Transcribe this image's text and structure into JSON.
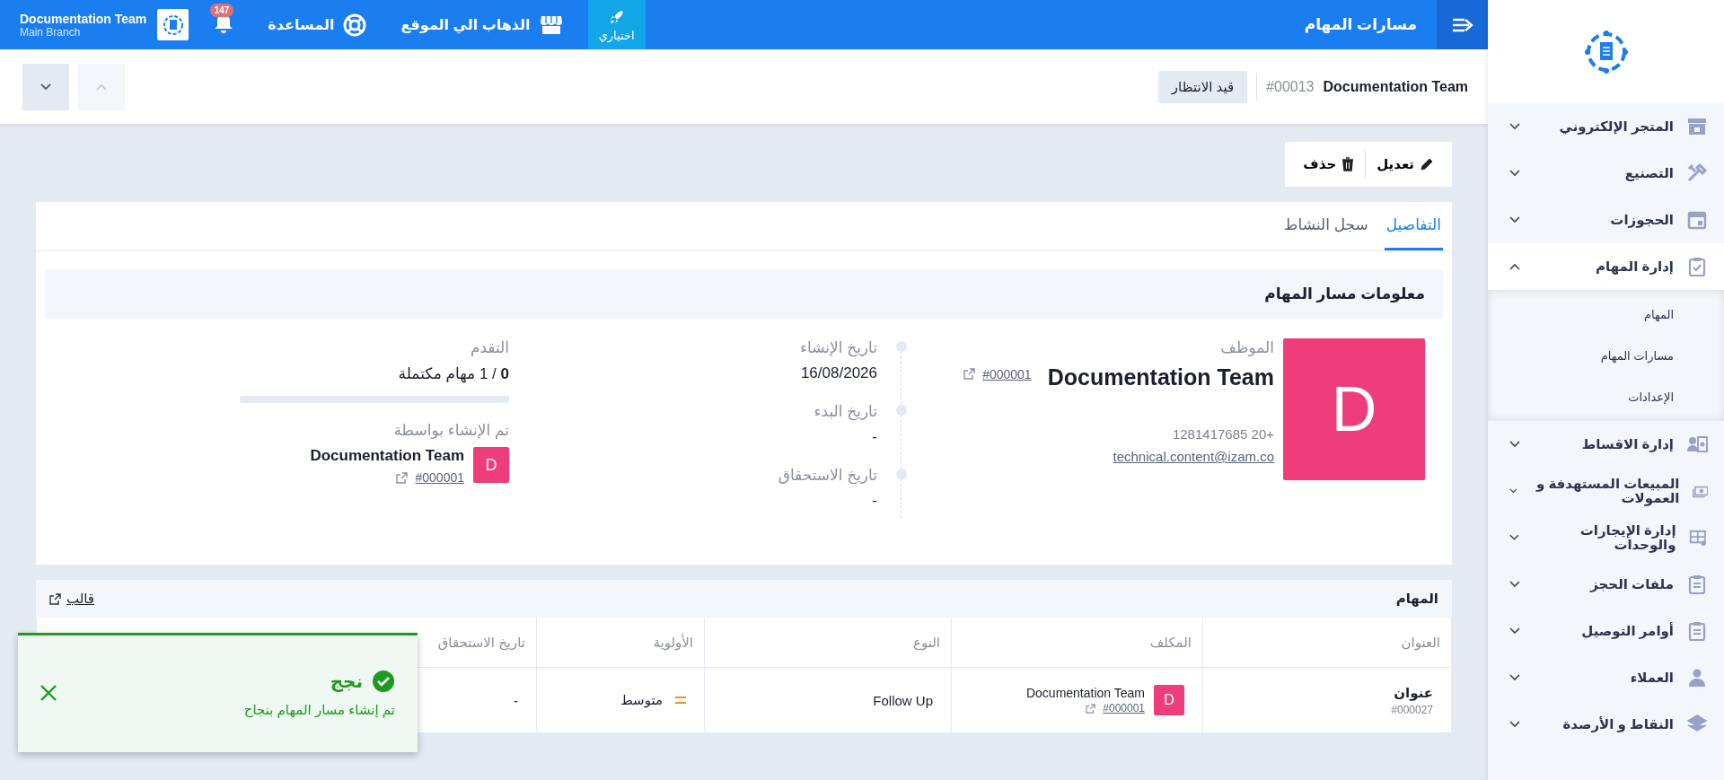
{
  "topbar": {
    "title": "مسارات المهام",
    "nav": [
      {
        "kind": "trial",
        "label": "اختياري"
      },
      {
        "kind": "site",
        "label": "الذهاب الي الموقع"
      },
      {
        "kind": "help",
        "label": "المساعدة"
      },
      {
        "kind": "notifications",
        "badge": "147"
      }
    ],
    "account": {
      "name": "Documentation Team",
      "branch": "Main Branch"
    }
  },
  "record": {
    "name": "Documentation Team",
    "number": "#00013",
    "status": "قيد الانتظار"
  },
  "actions": [
    {
      "kind": "edit",
      "label": "تعديل"
    },
    {
      "kind": "delete",
      "label": "حذف"
    }
  ],
  "tabs": [
    {
      "label": "التفاصيل",
      "selected": true
    },
    {
      "label": "سجل النشاط",
      "selected": false
    }
  ],
  "info": {
    "title": "معلومات مسار المهام",
    "employee": {
      "label": "الموظف",
      "initial": "D",
      "name": "Documentation Team",
      "code": "#000001",
      "phone": "+20 1281417685",
      "email": "technical.content@izam.co"
    },
    "dates": [
      {
        "label": "تاريخ الإنشاء",
        "value": "16/08/2026"
      },
      {
        "label": "تاريخ البدء",
        "value": "-"
      },
      {
        "label": "تاريخ الاستحقاق",
        "value": "-"
      }
    ],
    "progress": {
      "label": "التقدم",
      "text": "**0** / 1 مهام مكتملة",
      "level": 0
    },
    "created_by": {
      "label": "تم الإنشاء بواسطة",
      "initial": "D",
      "name": "Documentation Team",
      "code": "#000001"
    }
  },
  "tasks": {
    "title": "المهام",
    "template_link": "قالب",
    "columns": [
      "العنوان",
      "المكلف",
      "النوع",
      "الأولوية",
      "تاريخ الاستحقاق"
    ],
    "rows": [
      {
        "title": "عنوان",
        "number": "#000027",
        "assignee": {
          "initial": "D",
          "name": "Documentation Team",
          "code": "#000001"
        },
        "type": "Follow Up",
        "priority": "متوسط",
        "due": "-"
      }
    ]
  },
  "toast": {
    "title": "نجج",
    "message": "تم إنشاء مسار المهام بنجاح"
  },
  "sidebar": {
    "items": [
      {
        "label": "المتجر الإلكتروني",
        "expanded": false
      },
      {
        "label": "التصنيع",
        "expanded": false
      },
      {
        "label": "الحجوزات",
        "expanded": false
      },
      {
        "label": "إدارة المهام",
        "expanded": true,
        "children": [
          {
            "label": "المهام"
          },
          {
            "label": "مسارات المهام"
          },
          {
            "label": "الإعدادات"
          }
        ]
      },
      {
        "label": "إدارة الاقساط",
        "expanded": false
      },
      {
        "label": "المبيعات المستهدفة و العمولات",
        "expanded": false
      },
      {
        "label": "إدارة الإيجارات والوحدات",
        "expanded": false
      },
      {
        "label": "ملفات الحجز",
        "expanded": false
      },
      {
        "label": "أوامر التوصيل",
        "expanded": false
      },
      {
        "label": "العملاء",
        "expanded": false
      },
      {
        "label": "النقاط و الأرصدة",
        "expanded": false
      }
    ]
  }
}
